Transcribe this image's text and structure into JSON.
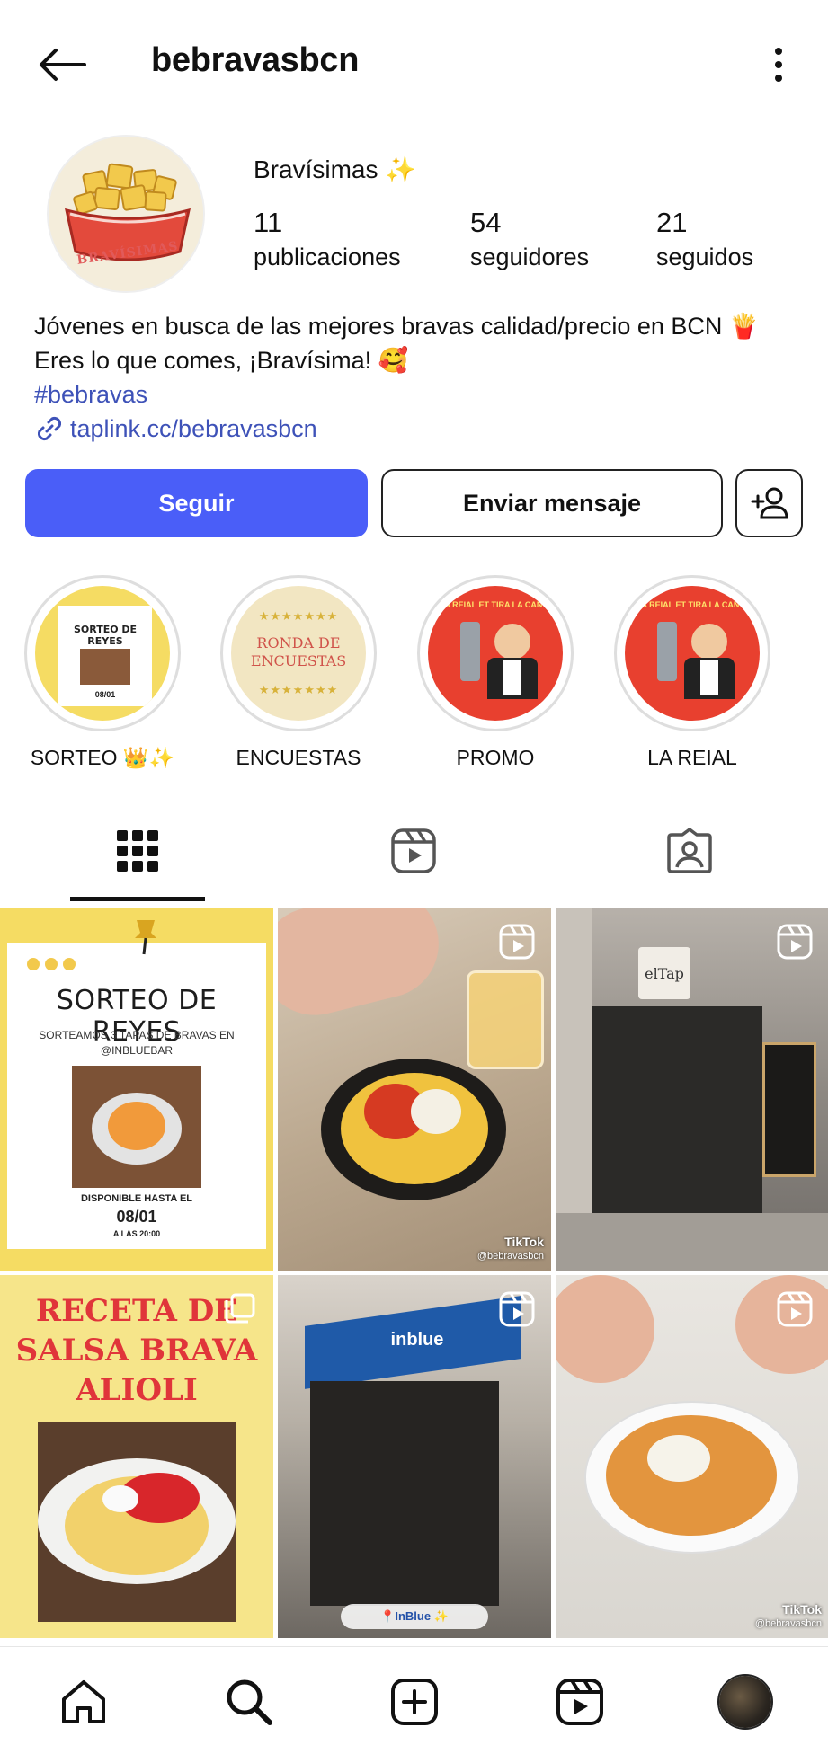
{
  "header": {
    "username": "bebravasbcn"
  },
  "profile": {
    "display_name": "Bravísimas ✨",
    "avatar_text": "BRAVÍSIMAS",
    "stats": [
      {
        "value": "11",
        "label": "publicaciones"
      },
      {
        "value": "54",
        "label": "seguidores"
      },
      {
        "value": "21",
        "label": "seguidos"
      }
    ],
    "bio_line1": "Jóvenes en busca de las mejores bravas calidad/precio en BCN 🍟",
    "bio_line2": "Eres lo que comes, ¡Bravísima! 🥰",
    "hashtag": "#bebravas",
    "link": "taplink.cc/bebravasbcn"
  },
  "actions": {
    "follow_label": "Seguir",
    "message_label": "Enviar mensaje"
  },
  "highlights": [
    {
      "label": "SORTEO 👑✨",
      "cover_title": "SORTEO DE REYES",
      "cover_date": "08/01"
    },
    {
      "label": "ENCUESTAS",
      "cover_title": "RONDA DE ENCUESTAS"
    },
    {
      "label": "PROMO",
      "cover_title": "LA REIAL ET TIRA LA CANYA"
    },
    {
      "label": "LA REIAL",
      "cover_title": "LA REIAL ET TIRA LA CANYA"
    }
  ],
  "tabs": [
    "grid-tab",
    "reels-tab",
    "tagged-tab"
  ],
  "posts": [
    {
      "type": "image",
      "title": "SORTEO DE REYES",
      "subtitle": "SORTEAMOS 3 TAPAS DE BRAVAS EN @INBLUEBAR",
      "footer1": "DISPONIBLE HASTA EL",
      "footer2": "08/01",
      "footer3": "A LAS 20:00"
    },
    {
      "type": "reel",
      "tiktok": "TikTok",
      "handle": "@bebravasbcn"
    },
    {
      "type": "reel",
      "sign": "elTap"
    },
    {
      "type": "image",
      "title_lines": [
        "RECETA DE",
        "SALSA BRAVA",
        "ALIOLI"
      ]
    },
    {
      "type": "reel",
      "sign": "inblue",
      "caption": "📍InBlue ✨"
    },
    {
      "type": "reel",
      "tiktok": "TikTok",
      "handle": "@bebravasbcn"
    }
  ],
  "colors": {
    "follow_button": "#4a5ef8",
    "link": "#3e52b8",
    "yellow_post": "#f5dc63",
    "receta_red": "#e0353a"
  },
  "bottom_nav": [
    "home-icon",
    "search-icon",
    "create-icon",
    "reels-icon",
    "profile-avatar"
  ]
}
